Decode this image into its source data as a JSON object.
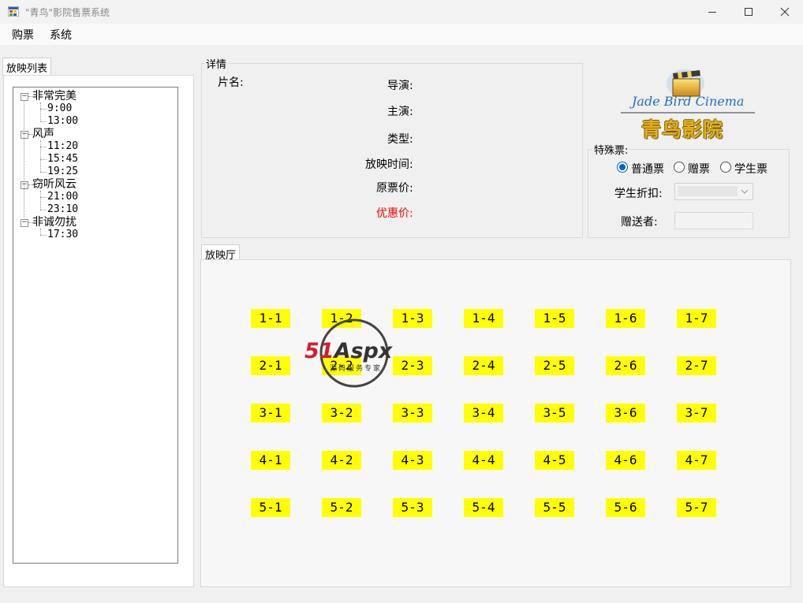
{
  "window": {
    "title": "\"青鸟\"影院售票系统"
  },
  "menu": {
    "items": [
      "购票",
      "系统"
    ]
  },
  "movie_tab": {
    "label": "放映列表"
  },
  "tree": {
    "movies": [
      {
        "name": "非常完美",
        "times": [
          "9:00",
          "13:00"
        ]
      },
      {
        "name": "风声",
        "times": [
          "11:20",
          "15:45",
          "19:25"
        ]
      },
      {
        "name": "窃听风云",
        "times": [
          "21:00",
          "23:10"
        ]
      },
      {
        "name": "非诚勿扰",
        "times": [
          "17:30"
        ]
      }
    ]
  },
  "details": {
    "legend": "详情",
    "name_label": "片名:",
    "director_label": "导演:",
    "actor_label": "主演:",
    "type_label": "类型:",
    "time_label": "放映时间:",
    "price_label": "原票价:",
    "discount_label": "优惠价:",
    "discount_color": "#ff0000"
  },
  "logo": {
    "english": "Jade Bird Cinema",
    "chinese": "青鸟影院"
  },
  "special": {
    "legend": "特殊票:",
    "options": [
      "普通票",
      "赠票",
      "学生票"
    ],
    "selected": "普通票",
    "student_discount_label": "学生折扣:",
    "giver_label": "赠送者:"
  },
  "hall": {
    "label": "放映厅",
    "seat_color": "#ffff00",
    "rows": [
      [
        "1-1",
        "1-2",
        "1-3",
        "1-4",
        "1-5",
        "1-6",
        "1-7"
      ],
      [
        "2-1",
        "2-2",
        "2-3",
        "2-4",
        "2-5",
        "2-6",
        "2-7"
      ],
      [
        "3-1",
        "3-2",
        "3-3",
        "3-4",
        "3-5",
        "3-6",
        "3-7"
      ],
      [
        "4-1",
        "4-2",
        "4-3",
        "4-4",
        "4-5",
        "4-6",
        "4-7"
      ],
      [
        "5-1",
        "5-2",
        "5-3",
        "5-4",
        "5-5",
        "5-6",
        "5-7"
      ]
    ]
  },
  "watermark": {
    "brand": "51Aspx",
    "tagline": "源码服务专家"
  }
}
